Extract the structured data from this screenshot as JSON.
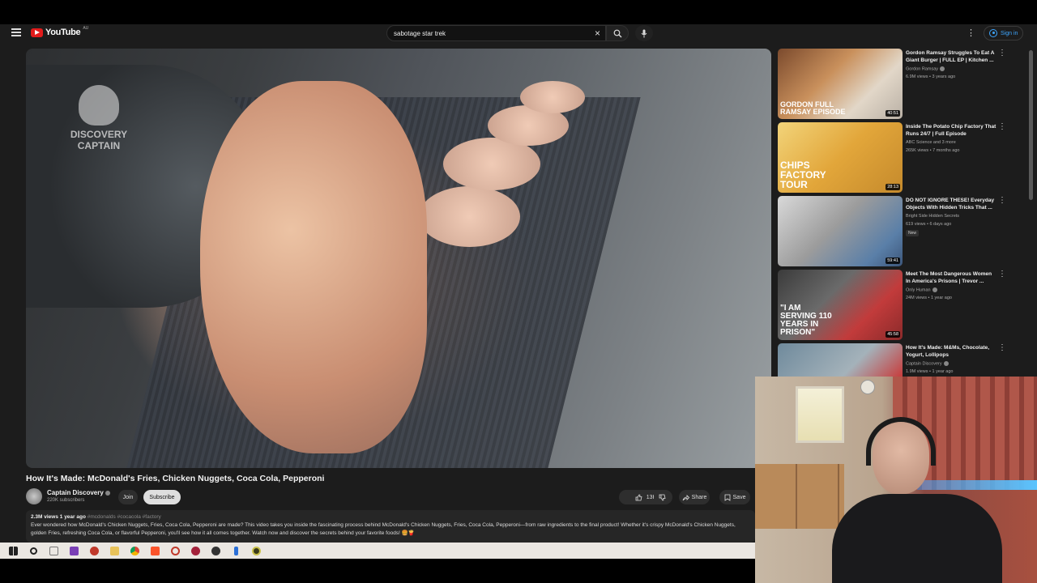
{
  "masthead": {
    "logo_text": "YouTube",
    "logo_region": "AU",
    "search_value": "sabotage star trek",
    "sign_in_label": "Sign in"
  },
  "video": {
    "title": "How It's Made: McDonald's Fries, Chicken Nuggets, Coca Cola, Pepperoni",
    "watermark": [
      "DISCOVERY",
      "CAPTAIN"
    ],
    "channel_name": "Captain Discovery",
    "subscribers": "220K subscribers",
    "join_label": "Join",
    "subscribe_label": "Subscribe",
    "like_count": "13K",
    "share_label": "Share",
    "save_label": "Save",
    "description_meta": "2.3M views  1 year ago",
    "description_tags": "#mcdonalds #cocacola #factory",
    "description_text": "Ever wondered how McDonald's Chicken Nuggets, Fries, Coca Cola, Pepperoni are made? This video takes you inside the fascinating process behind McDonald's Chicken Nuggets, Fries, Coca Cola, Pepperoni—from raw ingredients to the final product! Whether it's crispy McDonald's Chicken Nuggets, golden Fries, refreshing Coca Cola, or flavorful Pepperoni, you'll see how it all comes together. Watch now and discover the secrets behind your favorite foods! 🍔🍟"
  },
  "recommendations": [
    {
      "title": "Gordon Ramsay Struggles To Eat A Giant Burger | FULL EP | Kitchen ...",
      "channel": "Gordon Ramsay",
      "stats": "6.9M views • 3 years ago",
      "duration": "40:51",
      "thumb_text": "GORDON FULL RAMSAY EPISODE",
      "badge": ""
    },
    {
      "title": "Inside The Potato Chip Factory That Runs 24/7 | Full Episode",
      "channel": "ABC Science and 3 more",
      "stats": "265K views • 7 months ago",
      "duration": "28:13",
      "thumb_text": "CHIPS FACTORY TOUR",
      "badge": ""
    },
    {
      "title": "DO NOT IGNORE THESE! Everyday Objects With Hidden Tricks That ...",
      "channel": "Bright Side Hidden Secrets",
      "stats": "619 views • 6 days ago",
      "duration": "59:41",
      "thumb_text": "",
      "badge": "New"
    },
    {
      "title": "Meet The Most Dangerous Women In America's Prisons | Trevor ...",
      "channel": "Only Human",
      "stats": "24M views • 1 year ago",
      "duration": "45:58",
      "thumb_text": "\"I AM SERVING 110 YEARS IN PRISON\"",
      "badge": ""
    },
    {
      "title": "How It's Made: M&Ms, Chocolate, Yogurt, Lollipops",
      "channel": "Captain Discovery",
      "stats": "1.9M views • 1 year ago",
      "duration": "",
      "thumb_text": "",
      "badge": ""
    }
  ],
  "colors": {
    "brand_red": "#e21b1b",
    "link_blue": "#3ea6ff",
    "background": "#1c1c1c"
  },
  "icons": [
    "menu-icon",
    "search-icon",
    "clear-icon",
    "mic-icon",
    "more-vert-icon",
    "account-icon",
    "like-icon",
    "dislike-icon",
    "share-icon",
    "save-icon",
    "verified-icon",
    "windows-start-icon"
  ]
}
